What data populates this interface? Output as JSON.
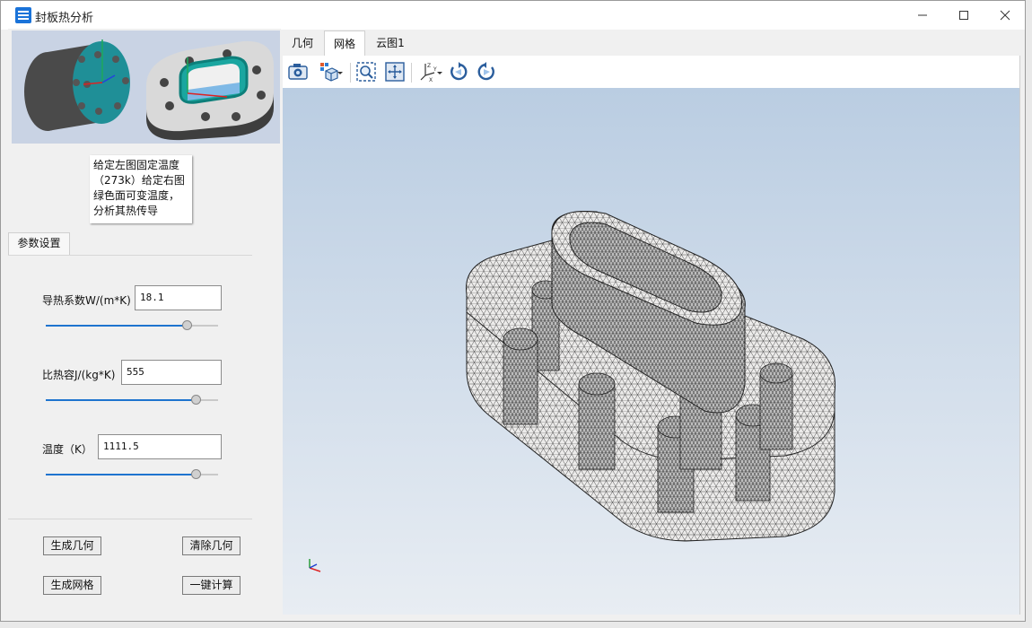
{
  "window": {
    "title": "封板热分析"
  },
  "preview": {
    "note": "给定左图固定温度（273k）给定右图绿色面可变温度，分析其热传导"
  },
  "params": {
    "group_tab": "参数设置",
    "conductivity": {
      "label": "导热系数W/(m*K)",
      "value": "18.1",
      "slider": 0.82
    },
    "heat_capacity": {
      "label": "比热容J/(kg*K)",
      "value": "555",
      "slider": 0.87
    },
    "temperature": {
      "label": "温度（K）",
      "value": "1111.5",
      "slider": 0.87
    }
  },
  "buttons": {
    "gen_geometry": "生成几何",
    "clear_geometry": "清除几何",
    "gen_mesh": "生成网格",
    "compute": "一键计算"
  },
  "tabs": [
    {
      "label": "几何"
    },
    {
      "label": "网格",
      "active": true
    },
    {
      "label": "云图1"
    }
  ],
  "toolbar": [
    "camera-icon",
    "view-cube-icon",
    "zoom-fit-icon",
    "pan-icon",
    "axes-icon",
    "rotate-left-icon",
    "rotate-right-icon"
  ]
}
